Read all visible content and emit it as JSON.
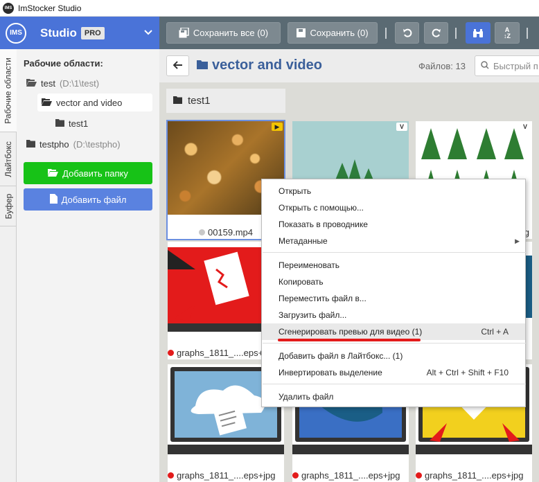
{
  "window": {
    "title": "ImStocker Studio"
  },
  "brand": {
    "logo": "IMS",
    "name": "Studio",
    "badge": "PRO"
  },
  "toolbar": {
    "save_all": "Сохранить все (0)",
    "save": "Сохранить (0)",
    "buttons": [
      "undo-icon",
      "redo-icon",
      "binoculars-icon",
      "sort-az-icon"
    ]
  },
  "vertical_tabs": [
    "Рабочие области",
    "Лайтбокс",
    "Буфер"
  ],
  "left_panel": {
    "heading": "Рабочие области:",
    "tree": [
      {
        "label": "test",
        "path": "(D:\\1\\test)"
      },
      {
        "label": "vector and video",
        "path": ""
      },
      {
        "label": "test1",
        "path": ""
      },
      {
        "label": "testpho",
        "path": "(D:\\testpho)"
      }
    ],
    "add_folder": "Добавить папку",
    "add_file": "Добавить файл"
  },
  "main": {
    "breadcrumb": "vector and video",
    "file_count": "Файлов: 13",
    "search_placeholder": "Быстрый п",
    "folder_chip": "test1"
  },
  "cards": [
    {
      "label": "00159.mp4",
      "status": "grey",
      "type": "video"
    },
    {
      "label": "",
      "status": "",
      "type": "vector"
    },
    {
      "label": "jpg",
      "status": "",
      "type": "vector"
    },
    {
      "label": "graphs_1811_....eps+jpg",
      "status": "red",
      "type": "vector"
    },
    {
      "label": "",
      "status": "",
      "type": "vector"
    },
    {
      "label": "",
      "status": "",
      "type": "vector"
    },
    {
      "label": "graphs_1811_....eps+jpg",
      "status": "red",
      "type": "vector"
    },
    {
      "label": "graphs_1811_....eps+jpg",
      "status": "red",
      "type": "vector"
    },
    {
      "label": "graphs_1811_....eps+jpg",
      "status": "red",
      "type": "vector"
    }
  ],
  "context_menu": {
    "items": [
      {
        "label": "Открыть",
        "shortcut": ""
      },
      {
        "label": "Открыть с помощью...",
        "shortcut": ""
      },
      {
        "label": "Показать в проводнике",
        "shortcut": ""
      },
      {
        "label": "Метаданные",
        "shortcut": "",
        "submenu": true
      },
      {
        "label": "Переименовать",
        "shortcut": ""
      },
      {
        "label": "Копировать",
        "shortcut": ""
      },
      {
        "label": "Переместить файл в...",
        "shortcut": ""
      },
      {
        "label": "Загрузить файл...",
        "shortcut": ""
      },
      {
        "label": "Сгенерировать превью для видео (1)",
        "shortcut": "Ctrl + A",
        "highlighted": true
      },
      {
        "label": "Добавить файл в Лайтбокс... (1)",
        "shortcut": ""
      },
      {
        "label": "Инвертировать выделение",
        "shortcut": "Alt + Ctrl + Shift + F10"
      },
      {
        "label": "Удалить файл",
        "shortcut": ""
      }
    ]
  },
  "colors": {
    "brand_blue": "#4a73d8",
    "toolbar": "#5a6a73",
    "green_button": "#17c217",
    "status_red": "#e31b1b",
    "underline_red": "#e31b1b"
  }
}
